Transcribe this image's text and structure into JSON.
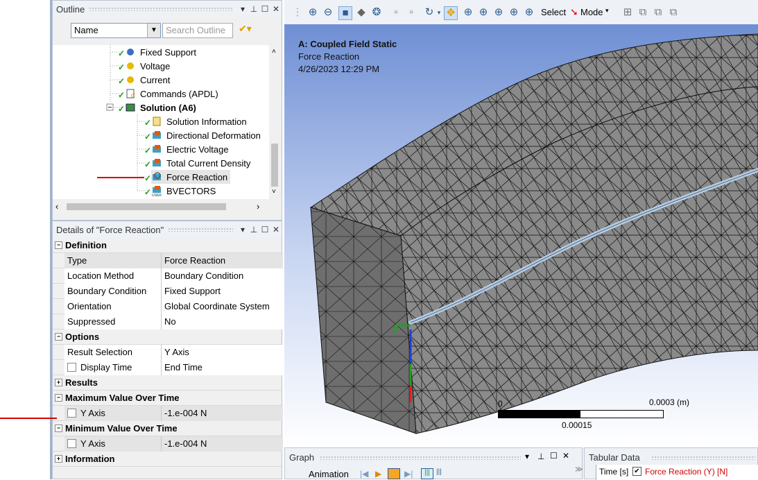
{
  "outline": {
    "title": "Outline",
    "filter_value": "Name",
    "search_placeholder": "Search Outline",
    "tree": [
      {
        "label": "Fixed Support",
        "icon": "fixed-support-icon"
      },
      {
        "label": "Voltage",
        "icon": "voltage-icon"
      },
      {
        "label": "Current",
        "icon": "current-icon"
      },
      {
        "label": "Commands (APDL)",
        "icon": "commands-icon"
      },
      {
        "label": "Solution (A6)",
        "icon": "solution-icon"
      },
      {
        "label": "Solution Information",
        "icon": "solution-info-icon"
      },
      {
        "label": "Directional Deformation",
        "icon": "result-icon"
      },
      {
        "label": "Electric Voltage",
        "icon": "result-icon"
      },
      {
        "label": "Total Current Density",
        "icon": "result-icon"
      },
      {
        "label": "Force Reaction",
        "icon": "probe-icon"
      },
      {
        "label": "BVECTORS",
        "icon": "user-result-icon"
      }
    ]
  },
  "details": {
    "title": "Details of \"Force Reaction\"",
    "sections": {
      "definition": "Definition",
      "options": "Options",
      "results": "Results",
      "max": "Maximum Value Over Time",
      "min": "Minimum Value Over Time",
      "information": "Information"
    },
    "rows": {
      "type_k": "Type",
      "type_v": "Force Reaction",
      "loc_k": "Location Method",
      "loc_v": "Boundary Condition",
      "bc_k": "Boundary Condition",
      "bc_v": "Fixed Support",
      "ori_k": "Orientation",
      "ori_v": "Global Coordinate System",
      "sup_k": "Suppressed",
      "sup_v": "No",
      "res_k": "Result Selection",
      "res_v": "Y Axis",
      "dt_k": "Display Time",
      "dt_v": "End Time",
      "maxy_k": "Y Axis",
      "maxy_v": "-1.e-004 N",
      "miny_k": "Y Axis",
      "miny_v": "-1.e-004 N"
    }
  },
  "toolbar": {
    "select_label": "Select",
    "mode_label": "Mode"
  },
  "viewport": {
    "analysis": "A: Coupled Field Static",
    "result": "Force Reaction",
    "timestamp": "4/26/2023 12:29 PM",
    "scale_start": "0",
    "scale_end": "0.0003 (m)",
    "scale_mid": "0.00015"
  },
  "bottom": {
    "graph_title": "Graph",
    "animation_label": "Animation",
    "tabular_title": "Tabular Data",
    "col_time": "Time [s]",
    "col_force": "Force Reaction (Y) [N]"
  },
  "colors": {
    "accent": "#2d5c93",
    "annotation": "#d90000",
    "check": "#1aa01a"
  }
}
